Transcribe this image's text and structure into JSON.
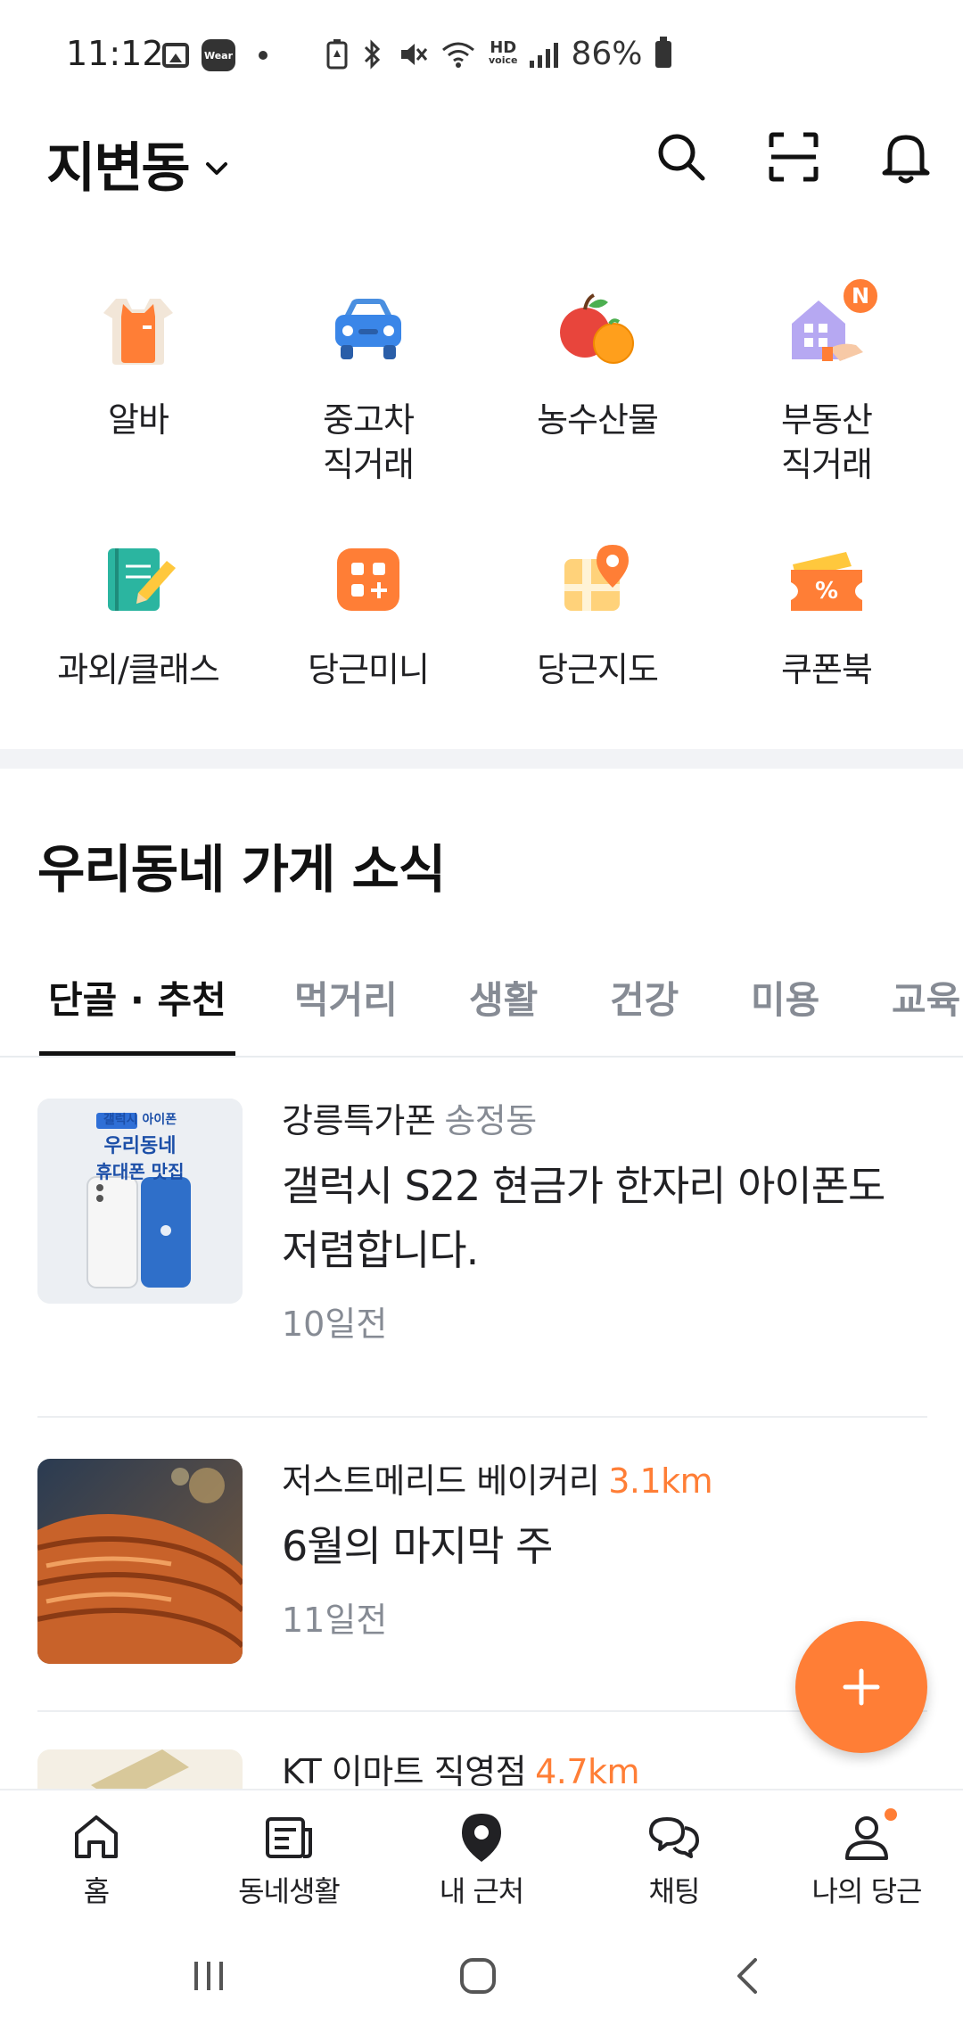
{
  "status_bar": {
    "time": "11:12",
    "wear_label": "Wear",
    "hd_label": "HD",
    "voice_label": "voice",
    "battery": "86%",
    "left_icons": [
      "gallery-icon",
      "wear-icon",
      "dot-icon"
    ],
    "right_icons": [
      "battery-saver-icon",
      "bluetooth-icon",
      "mute-icon",
      "wifi-icon",
      "hd-voice-icon",
      "signal-icon",
      "battery-icon"
    ]
  },
  "header": {
    "location": "지변동",
    "icons": [
      "search-icon",
      "scan-icon",
      "bell-icon"
    ]
  },
  "categories": [
    {
      "label": "알바",
      "icon": "apron-icon"
    },
    {
      "label": "중고차\n직거래",
      "icon": "car-icon"
    },
    {
      "label": "농수산물",
      "icon": "fruit-icon"
    },
    {
      "label": "부동산\n직거래",
      "icon": "house-icon",
      "badge": "N"
    },
    {
      "label": "과외/클래스",
      "icon": "notebook-icon"
    },
    {
      "label": "당근미니",
      "icon": "mini-app-icon"
    },
    {
      "label": "당근지도",
      "icon": "map-icon"
    },
    {
      "label": "쿠폰북",
      "icon": "coupon-icon"
    }
  ],
  "section": {
    "title": "우리동네 가게 소식"
  },
  "tabs": [
    {
      "label": "단골 · 추천",
      "active": true
    },
    {
      "label": "먹거리",
      "active": false
    },
    {
      "label": "생활",
      "active": false
    },
    {
      "label": "건강",
      "active": false
    },
    {
      "label": "미용",
      "active": false
    },
    {
      "label": "교육",
      "active": false
    }
  ],
  "feed": [
    {
      "store": "강릉특가폰",
      "location": "송정동",
      "title": "갤럭시 S22 현금가 한자리 아이폰도 저렴합니다.",
      "time": "10일전",
      "thumb_lines": [
        "갤럭시 아이폰",
        "우리동네",
        "휴대폰 맛집"
      ]
    },
    {
      "store": "저스트메리드 베이커리",
      "distance": "3.1km",
      "title": "6월의 마지막 주",
      "time": "11일전"
    },
    {
      "store": "KT 이마트 직영점",
      "distance": "4.7km"
    }
  ],
  "fab": {
    "icon": "plus-icon"
  },
  "bottom_nav": [
    {
      "label": "홈",
      "icon": "home-icon"
    },
    {
      "label": "동네생활",
      "icon": "newspaper-icon"
    },
    {
      "label": "내 근처",
      "icon": "location-pin-icon",
      "active": true
    },
    {
      "label": "채팅",
      "icon": "chat-icon"
    },
    {
      "label": "나의 당근",
      "icon": "profile-icon",
      "dot": true
    }
  ],
  "colors": {
    "accent": "#ff7e36",
    "text": "#212124",
    "muted": "#868b94"
  }
}
